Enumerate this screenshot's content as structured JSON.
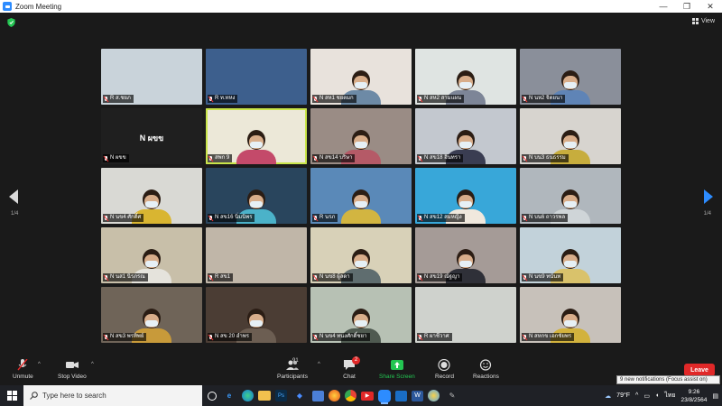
{
  "window": {
    "title": "Zoom Meeting",
    "minimize": "—",
    "maximize": "❐",
    "close": "✕"
  },
  "header": {
    "view_label": "View"
  },
  "pagination": {
    "left": "1/4",
    "right": "1/4"
  },
  "tiles": [
    {
      "name": "R ส.ชยภ",
      "bg": "#c9d3da",
      "person": false
    },
    {
      "name": "R ท.ทหง",
      "bg": "#3d5f8d",
      "person": false
    },
    {
      "name": "N สห1 ชยตมก",
      "bg": "#e8e2dc",
      "person": true,
      "shirt": "#6d8aa6"
    },
    {
      "name": "N สห2 สามแผน",
      "bg": "#dfe4e2",
      "person": true,
      "shirt": "#7d8597"
    },
    {
      "name": "N นห2 จิตยนา",
      "bg": "#8a8f9a",
      "person": true,
      "shirt": "#5f84b6"
    },
    {
      "name": "N ผขข",
      "bg": "#1f1f1f",
      "person": false,
      "center": "N ผขข"
    },
    {
      "name": "สพก 9",
      "bg": "#ece8d8",
      "person": true,
      "shirt": "#c44a6a",
      "active": true
    },
    {
      "name": "N สข14 บริษา",
      "bg": "#9a8c85",
      "person": true,
      "shirt": "#b55a67"
    },
    {
      "name": "N สข18 อินทรา",
      "bg": "#c3c8cf",
      "person": true,
      "shirt": "#3a3d52"
    },
    {
      "name": "N บน3 ธนธรรม",
      "bg": "#d7d4cf",
      "person": true,
      "shirt": "#c7ad3d"
    },
    {
      "name": "N นข4 ศักดิ์ศ",
      "bg": "#d9d9d4",
      "person": true,
      "shirt": "#d9b531"
    },
    {
      "name": "N สข16 นิ่มนิพร",
      "bg": "#29455d",
      "person": true,
      "shirt": "#4bb2c9"
    },
    {
      "name": "R นรภ",
      "bg": "#5a89b8",
      "person": true,
      "shirt": "#d2b541"
    },
    {
      "name": "N สข12 สมหญิง",
      "bg": "#38a7d9",
      "person": true,
      "shirt": "#f0e8dd"
    },
    {
      "name": "N บน6 ถาวรพล",
      "bg": "#b0b7bd",
      "person": true,
      "shirt": "#cfd5d8"
    },
    {
      "name": "N นส1 นิรภรณ",
      "bg": "#c8bfa9",
      "person": true,
      "shirt": "#e5e3dc"
    },
    {
      "name": "R สข1",
      "bg": "#c0b6a8",
      "person": false
    },
    {
      "name": "N นข8 ผู้ลดา",
      "bg": "#d8d1b8",
      "person": true,
      "shirt": "#5f6d6f"
    },
    {
      "name": "N สข19 ณัฐญา",
      "bg": "#a59b97",
      "person": true,
      "shirt": "#2f3038"
    },
    {
      "name": "N นข9 ทนันท",
      "bg": "#c2d2da",
      "person": true,
      "shirt": "#d9c26b"
    },
    {
      "name": "N สข3 พรทิพย์",
      "bg": "#6f6458",
      "person": true,
      "shirt": "#c89a3a"
    },
    {
      "name": "N สข 20 อำพร",
      "bg": "#4b3d34",
      "person": true,
      "shirt": "#6c5e52"
    },
    {
      "name": "N นข4 ทนงศักดิ์ชยา",
      "bg": "#b7c1b4",
      "person": true,
      "shirt": "#4f5a50"
    },
    {
      "name": "R ผาชีวาศ",
      "bg": "#cfd2cd",
      "person": false
    },
    {
      "name": "N สหกข เอกชัยพร",
      "bg": "#c7c1ba",
      "person": true,
      "shirt": "#d2b23d"
    }
  ],
  "toolbar": {
    "unmute": "Unmute",
    "stop_video": "Stop Video",
    "participants": "Participants",
    "participants_count": "91",
    "chat": "Chat",
    "chat_badge": "2",
    "share_screen": "Share Screen",
    "record": "Record",
    "reactions": "Reactions",
    "leave": "Leave"
  },
  "notification": "9 new notifications (Focus assist on)",
  "taskbar": {
    "search_placeholder": "Type here to search",
    "weather": "79°F",
    "language": "ไทย",
    "time": "9:26",
    "date": "23/8/2564"
  },
  "colors": {
    "accent": "#2d8cff",
    "leave": "#e02828",
    "share": "#23c552",
    "active_speaker": "#c9e54a"
  }
}
